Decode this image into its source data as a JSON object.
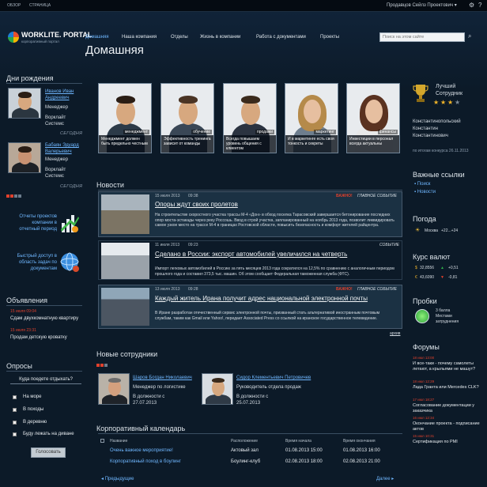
{
  "topbar": {
    "overview": "ОБЗОР",
    "page": "СТРАНИЦА",
    "user": "Продавцов Сейлз Проектович"
  },
  "logo": {
    "name": "WORKLITE. PORTAL",
    "sub": "корпоративный портал"
  },
  "nav": [
    "Домашняя",
    "Наша компания",
    "Отделы",
    "Жизнь в компании",
    "Работа с документами",
    "Проекты"
  ],
  "search": {
    "placeholder": "Поиск на этом сайте"
  },
  "page_title": "Домашняя",
  "birthdays": {
    "title": "Дни рождения",
    "people": [
      {
        "name1": "Иванов Иван",
        "name2": "Андреевич",
        "role": "Менеджер",
        "company1": "Ворклайт",
        "company2": "Системс",
        "when": "СЕГОДНЯ"
      },
      {
        "name1": "Бабаян Эдуард",
        "name2": "Валерьевич",
        "role": "Менеджер",
        "company1": "Ворклайт",
        "company2": "Системс",
        "when": "СЕГОДНЯ"
      }
    ]
  },
  "promos": [
    {
      "text1": "Отчеты проектов",
      "text2": "компании в",
      "text3": "отчетный период"
    },
    {
      "text1": "Быстрый доступ в",
      "text2": "область задач по",
      "text3": "документам"
    }
  ],
  "ads": {
    "title": "Объявления",
    "items": [
      {
        "date": "15 июля 09:04",
        "text": "Сдам двухкомнатную квартиру"
      },
      {
        "date": "15 июля 23:31",
        "text": "Продам детскую кроватку"
      }
    ]
  },
  "poll": {
    "title": "Опросы",
    "question": "Куда поедете отдыхать?",
    "options": [
      "На море",
      "В походы",
      "В деревню",
      "Буду лежать на диване"
    ],
    "button": "Голосовать"
  },
  "tiles": [
    {
      "tag": "менеджмент",
      "caption": "Менеджмент должен быть предельно честным"
    },
    {
      "tag": "обучение",
      "caption": "Эффективность тренинга зависит от команды"
    },
    {
      "tag": "продажи",
      "caption": "Всегда повышаем уровень общения с клиентом"
    },
    {
      "tag": "маркетинг",
      "caption": "И в маркетинге есть своя тонкость и секреты"
    },
    {
      "tag": "финансы",
      "caption": "Инвестиции в персонал всегда актуальны"
    }
  ],
  "news": {
    "title": "Новости",
    "more": "архив",
    "items": [
      {
        "date": "15 июля 2013",
        "time": "09:38",
        "flag": "ВАЖНО!",
        "badge": "ГЛАВНОЕ СОБЫТИЕ",
        "title": "Опоры ждут своих пролетов",
        "body": "На строительстве скоростного участка трассы М-4 «Дон» в обход поселка Тарасовский завершается бетонирование последних опор моста-эстакады через реку Россошь. Ввод в строй участка, запланированный на ноябрь 2013 года, позволит ликвидировать самое узкое место на трассе М-4 в границах Ростовской области, повысить безопасность и комфорт жителей райцентра."
      },
      {
        "date": "11 июля 2013",
        "time": "09:23",
        "flag": "",
        "badge": "СОБЫТИЕ",
        "title": "Сделано в России: экспорт автомобилей увеличился на четверть",
        "body": "Импорт легковых автомобилей в Россию за пять месяцев 2013 года сократился на 12,5% по сравнению с аналогичным периодом прошлого года и составил 373,5 тыс. машин. Об этом сообщает Федеральная таможенная служба (ФТС)."
      },
      {
        "date": "13 июля 2013",
        "time": "09:28",
        "flag": "ВАЖНО!",
        "badge": "ГЛАВНОЕ СОБЫТИЕ",
        "title": "Каждый житель Ирана получит адрес национальной электронной почты",
        "body": "В Иране разработан отечественный сервис электронной почты, призванный стать альтернативой иностранным почтовым службам, таким как Gmail или Yahoo!, передает Associated Press со ссылкой на иранское государственное телевидение."
      }
    ]
  },
  "newemployees": {
    "title": "Новые сотрудники",
    "people": [
      {
        "name": "Шаров Богдан Николаевич",
        "role": "Менеджер по логистике",
        "since1": "В должности с",
        "since2": "27.07.2013"
      },
      {
        "name": "Сидор Клементьевич Петровичев",
        "role": "Руководитель отдела продаж",
        "since1": "В должности с",
        "since2": "25.07.2013"
      }
    ]
  },
  "calendar": {
    "title": "Корпоративный календарь",
    "headers": [
      "Название",
      "Расположение",
      "Время начала",
      "Время окончания"
    ],
    "rows": [
      [
        "Очень важное мероприятие!",
        "Актовый зал",
        "01.08.2013 15:00",
        "01.08.2013 16:00"
      ],
      [
        "Корпоративный поход в боулинг",
        "Боулинг-клуб",
        "02.08.2013 18:00",
        "02.08.2013 21:00"
      ]
    ],
    "prev": "Предыдущие",
    "next": "Далее"
  },
  "best": {
    "title1": "Лучший",
    "title2": "Сотрудник",
    "name1": "Константинопольский",
    "name2": "Константин",
    "name3": "Константинович",
    "note": "по итогам конкурса 26.11.2013"
  },
  "links": {
    "title": "Важные ссылки",
    "items": [
      "Поиск",
      "Новости"
    ]
  },
  "weather": {
    "title": "Погода",
    "city": "Москва",
    "temp": "+22...+24"
  },
  "rates": {
    "title": "Курс валют",
    "items": [
      {
        "sym": "$",
        "value": "32,8556",
        "delta": "+0,51"
      },
      {
        "sym": "€",
        "value": "43,6090",
        "delta": "-0,81"
      }
    ]
  },
  "traffic": {
    "title": "Пробки",
    "text1": "3 балла",
    "text2": "Местами",
    "text3": "затруднения"
  },
  "forums": {
    "title": "Форумы",
    "items": [
      {
        "date": "18 июл 13:00",
        "text": "И все-таки - почему самолеты летают, а крыльями не машут?"
      },
      {
        "date": "18 июл 12:29",
        "text": "Лада Гранта или Mercedes CLK?"
      },
      {
        "date": "17 июл 18:27",
        "text": "Согласование документации у заказчика"
      },
      {
        "date": "16 июл 12:34",
        "text": "Окончание проекта - подписание актов"
      },
      {
        "date": "15 июл 10:31",
        "text": "Сертификация по PMI"
      }
    ]
  },
  "colors": {
    "accent": "#6fb7ff",
    "bg": "#0c1a28",
    "important": "#e0402c"
  }
}
